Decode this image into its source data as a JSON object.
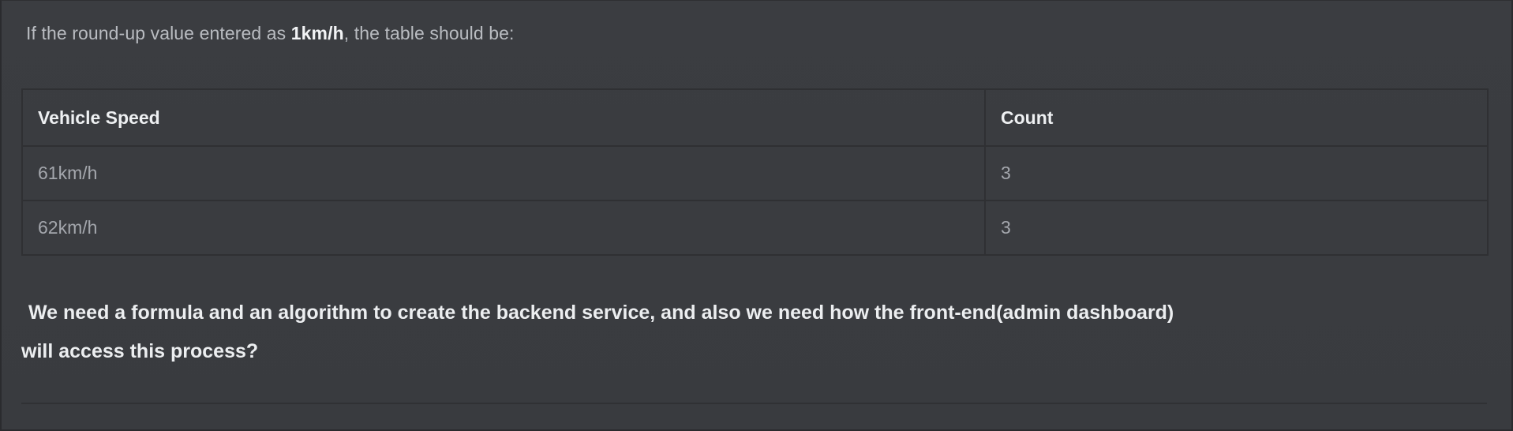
{
  "intro": {
    "prefix": "If the round-up value entered as ",
    "value": "1km/h",
    "suffix": ", the table should be:"
  },
  "table": {
    "headers": [
      "Vehicle Speed",
      "Count"
    ],
    "rows": [
      [
        "61km/h",
        "3"
      ],
      [
        "62km/h",
        "3"
      ]
    ]
  },
  "question": {
    "line1": "We need a formula and an algorithm to create the backend service, and also we need how the front-end(admin dashboard)",
    "line2": "will access this process?"
  },
  "colors": {
    "background": "#3a3c40",
    "border": "#2f3033",
    "heading_text": "#eef0f2",
    "body_text": "#a4a7ad"
  }
}
